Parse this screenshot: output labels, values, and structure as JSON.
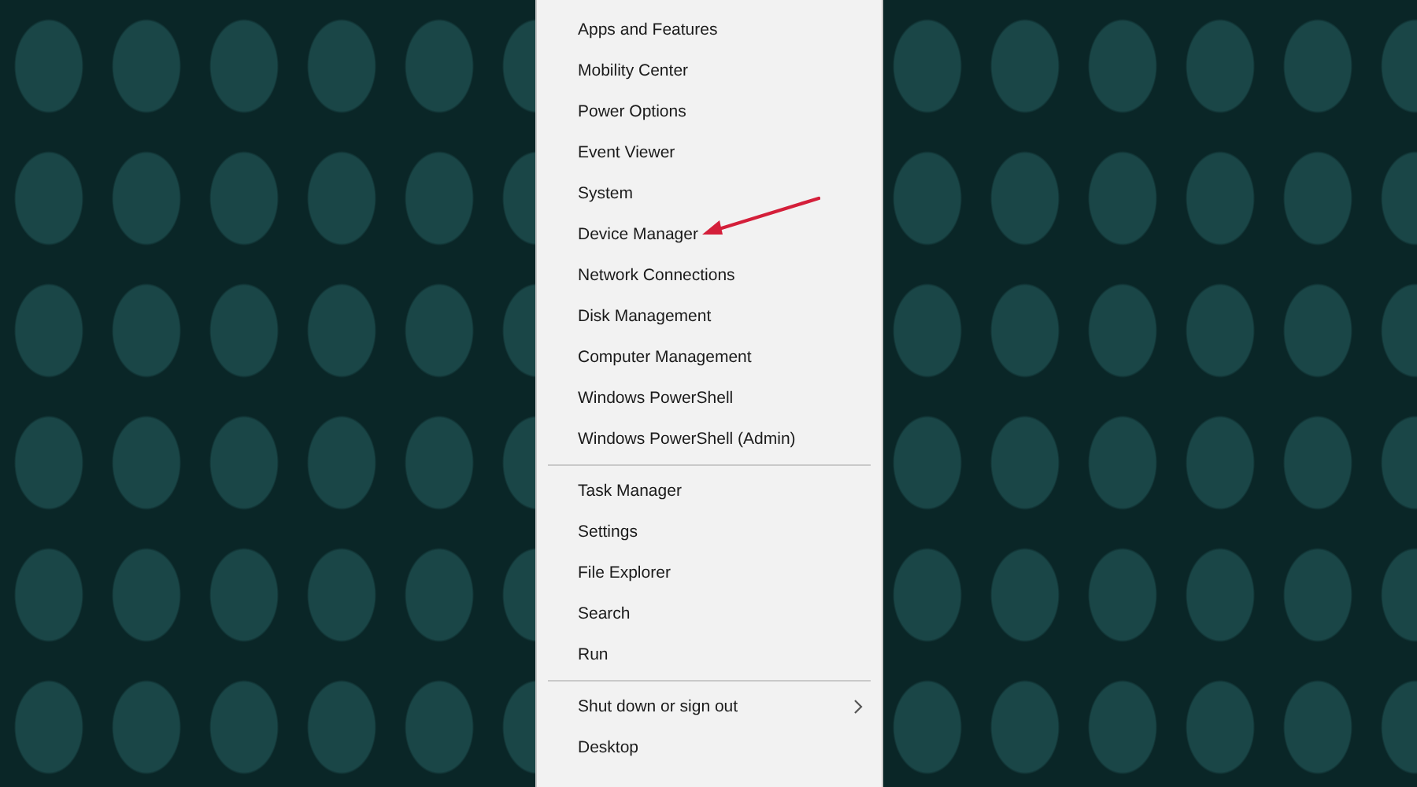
{
  "menu": {
    "groups": [
      {
        "items": [
          {
            "label": "Apps and Features",
            "has_submenu": false,
            "arrow_pointed": false
          },
          {
            "label": "Mobility Center",
            "has_submenu": false,
            "arrow_pointed": false
          },
          {
            "label": "Power Options",
            "has_submenu": false,
            "arrow_pointed": false
          },
          {
            "label": "Event Viewer",
            "has_submenu": false,
            "arrow_pointed": false
          },
          {
            "label": "System",
            "has_submenu": false,
            "arrow_pointed": false
          },
          {
            "label": "Device Manager",
            "has_submenu": false,
            "arrow_pointed": true
          },
          {
            "label": "Network Connections",
            "has_submenu": false,
            "arrow_pointed": false
          },
          {
            "label": "Disk Management",
            "has_submenu": false,
            "arrow_pointed": false
          },
          {
            "label": "Computer Management",
            "has_submenu": false,
            "arrow_pointed": false
          },
          {
            "label": "Windows PowerShell",
            "has_submenu": false,
            "arrow_pointed": false
          },
          {
            "label": "Windows PowerShell (Admin)",
            "has_submenu": false,
            "arrow_pointed": false
          }
        ]
      },
      {
        "items": [
          {
            "label": "Task Manager",
            "has_submenu": false,
            "arrow_pointed": false
          },
          {
            "label": "Settings",
            "has_submenu": false,
            "arrow_pointed": false
          },
          {
            "label": "File Explorer",
            "has_submenu": false,
            "arrow_pointed": false
          },
          {
            "label": "Search",
            "has_submenu": false,
            "arrow_pointed": false
          },
          {
            "label": "Run",
            "has_submenu": false,
            "arrow_pointed": false
          }
        ]
      },
      {
        "items": [
          {
            "label": "Shut down or sign out",
            "has_submenu": true,
            "arrow_pointed": false
          },
          {
            "label": "Desktop",
            "has_submenu": false,
            "arrow_pointed": false
          }
        ]
      }
    ]
  }
}
